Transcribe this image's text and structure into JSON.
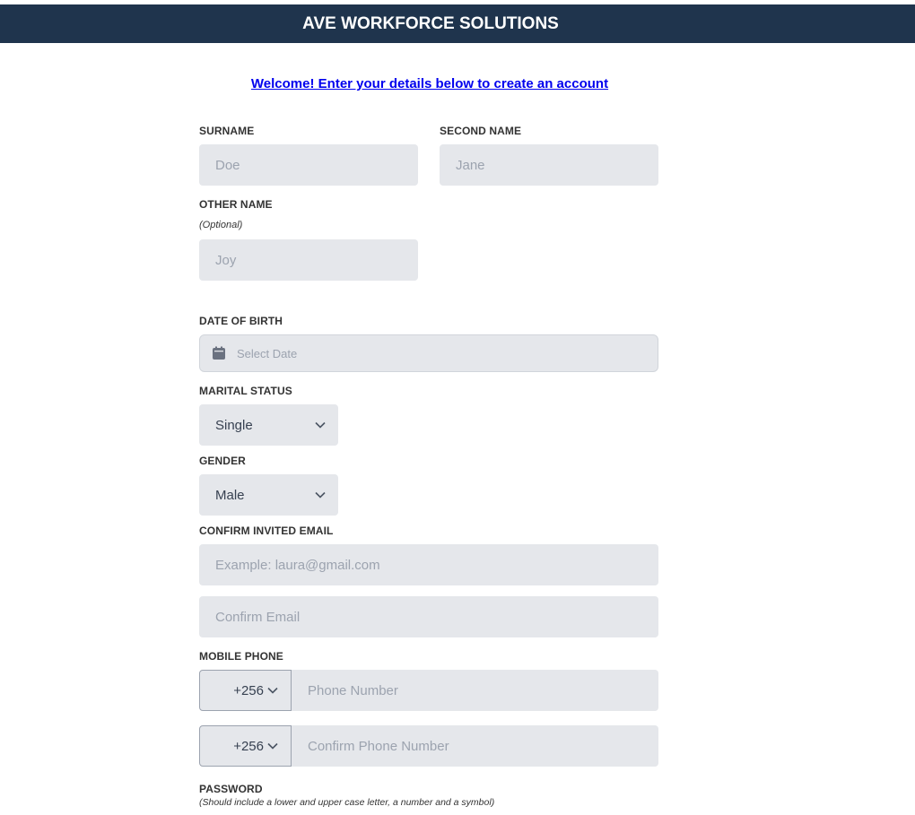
{
  "header": {
    "title": "AVE WORKFORCE SOLUTIONS"
  },
  "welcome": "Welcome! Enter your details below to create an account",
  "fields": {
    "surname": {
      "label": "SURNAME",
      "placeholder": "Doe"
    },
    "second_name": {
      "label": "SECOND NAME",
      "placeholder": "Jane"
    },
    "other_name": {
      "label": "OTHER NAME",
      "hint": "(Optional)",
      "placeholder": "Joy"
    },
    "dob": {
      "label": "DATE OF BIRTH",
      "placeholder": "Select Date",
      "icon": "calendar-icon"
    },
    "marital": {
      "label": "MARITAL STATUS",
      "value": "Single"
    },
    "gender": {
      "label": "GENDER",
      "value": "Male"
    },
    "email": {
      "label": "CONFIRM INVITED EMAIL",
      "placeholder": "Example: laura@gmail.com",
      "confirm_placeholder": "Confirm Email"
    },
    "phone": {
      "label": "MOBILE PHONE",
      "country_code": "+256",
      "placeholder": "Phone Number",
      "confirm_country_code": "+256",
      "confirm_placeholder": "Confirm Phone Number"
    },
    "password": {
      "label": "PASSWORD",
      "hint": "(Should include a lower and upper case letter, a number and a symbol)"
    }
  },
  "colors": {
    "header_bg": "#1f344d",
    "input_bg": "#e5e7eb",
    "link": "#0000ee"
  }
}
